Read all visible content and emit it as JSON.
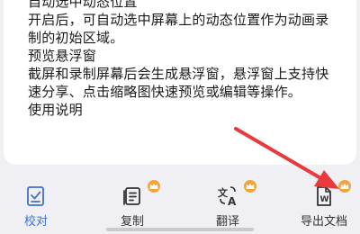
{
  "content": {
    "lines": [
      "自动选中动态位置",
      "开启后，可自动选中屏幕上的动态位置作为动画录",
      "制的初始区域。",
      "预览悬浮窗",
      "截屏和录制屏幕后会生成悬浮窗，悬浮窗上支持快",
      "速分享、点击缩略图快速预览或编辑等操作。",
      "使用说明"
    ]
  },
  "toolbar": {
    "items": [
      {
        "label": "校对",
        "icon": "proofread-icon",
        "active": true,
        "premium": false
      },
      {
        "label": "复制",
        "icon": "copy-icon",
        "active": false,
        "premium": true
      },
      {
        "label": "翻译",
        "icon": "translate-icon",
        "active": false,
        "premium": true
      },
      {
        "label": "导出文档",
        "icon": "export-doc-icon",
        "active": false,
        "premium": true
      }
    ]
  },
  "colors": {
    "accent": "#3f6fd1",
    "premium_badge": "#f2a33a",
    "annotation_arrow": "#e8393b"
  }
}
